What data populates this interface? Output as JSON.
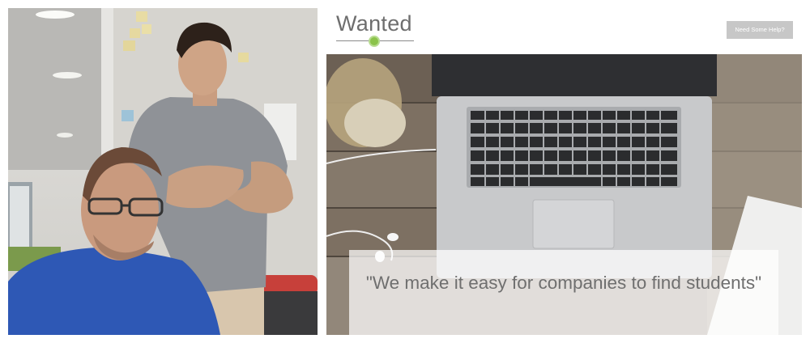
{
  "site": {
    "logo_text": "Wanted",
    "help_button_label": "Need Some Help?",
    "hero_quote": "\"We make it easy for companies to find students\""
  },
  "colors": {
    "logo_dot": "#8bc34a",
    "help_button_bg": "#c7c7c7",
    "quote_text": "#6f6f6f"
  },
  "icons": [
    "logo-dot-icon"
  ]
}
